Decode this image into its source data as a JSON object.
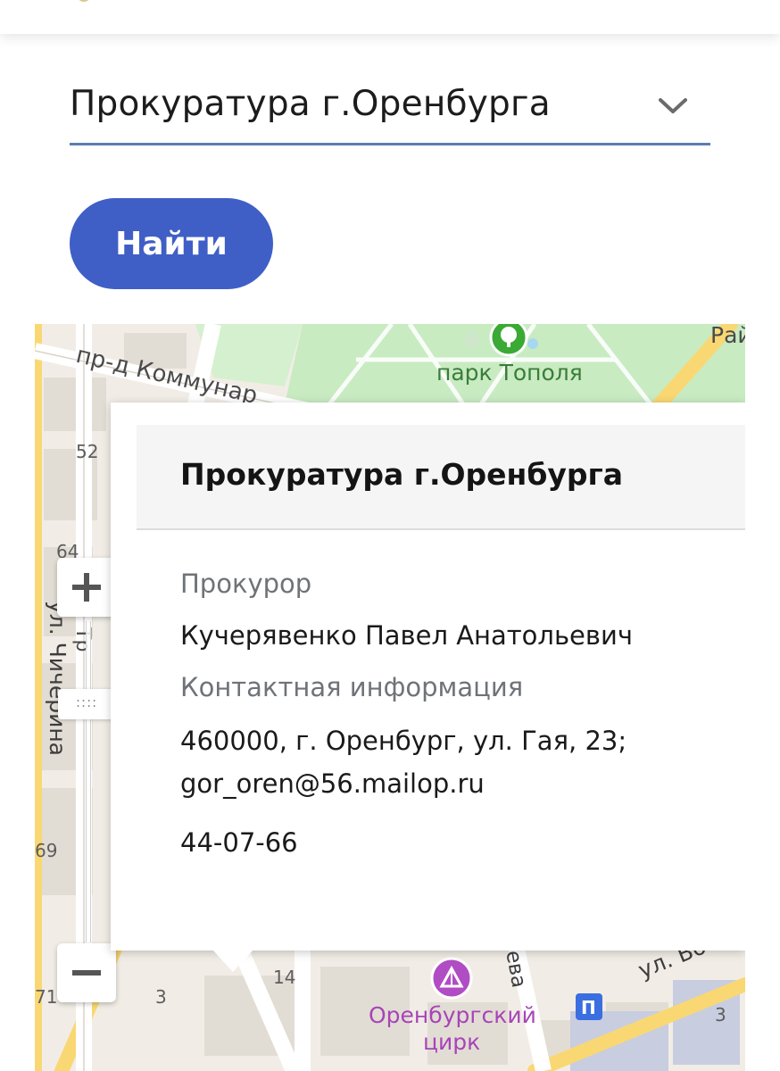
{
  "filter": {
    "selected_value": "Прокуратура г.Оренбурга",
    "dropdown_icon": "chevron-down-icon"
  },
  "search_button": {
    "label": "Найти"
  },
  "map": {
    "labels": {
      "street_kommunarov": "пр-д Коммунар",
      "park": "парк Тополя",
      "street_chicherina": "ул. Чичерина",
      "rai": "Рай",
      "house_52": "52",
      "house_64": "64",
      "house_69": "69",
      "house_71": "71",
      "house_3": "3",
      "house_14": "14",
      "house_3b": "3",
      "street_eva": "ева",
      "street_vo": "ул. Во",
      "street_tr": "Тр",
      "circus_line1": "Оренбургский",
      "circus_line2": "цирк"
    },
    "icons": [
      "park-tree-icon",
      "circus-icon",
      "metro-icon"
    ],
    "controls": {
      "zoom_in": "plus-icon",
      "zoom_out": "minus-icon",
      "handle_label": "::::"
    },
    "colors": {
      "park": "#c9ebc2",
      "road_major": "#f9d873",
      "circus": "#b04cc4",
      "poi_green": "#3aaa35"
    }
  },
  "popup": {
    "title": "Прокуратура г.Оренбурга",
    "prosecutor_label": "Прокурор",
    "prosecutor_name": "Кучерявенко Павел Анатольевич",
    "contacts_label": "Контактная информация",
    "address": "460000, г. Оренбург, ул. Гая, 23;",
    "email": "gor_oren@56.mailop.ru",
    "phone": "44-07-66"
  },
  "colors": {
    "accent": "#3f5fc6",
    "underline": "#5a7fb0"
  }
}
